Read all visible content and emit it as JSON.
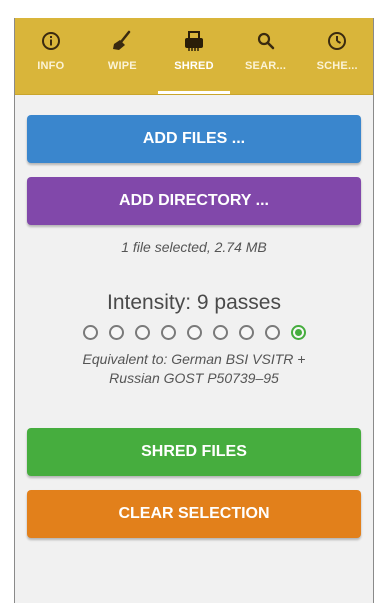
{
  "tabs": [
    {
      "label": "INFO",
      "icon": "info-icon"
    },
    {
      "label": "WIPE",
      "icon": "broom-icon"
    },
    {
      "label": "SHRED",
      "icon": "shredder-icon",
      "active": true
    },
    {
      "label": "SEAR...",
      "icon": "search-icon"
    },
    {
      "label": "SCHE...",
      "icon": "clock-icon"
    }
  ],
  "buttons": {
    "add_files": "ADD FILES ...",
    "add_directory": "ADD DIRECTORY ...",
    "shred_files": "SHRED FILES",
    "clear_selection": "CLEAR SELECTION"
  },
  "selection": {
    "info": "1 file selected, 2.74 MB"
  },
  "intensity": {
    "title": "Intensity: 9 passes",
    "selected_passes": 9,
    "max_passes": 9,
    "equivalent_line1": "Equivalent to: German BSI VSITR +",
    "equivalent_line2": "Russian GOST P50739–95"
  },
  "colors": {
    "tabbar": "#d9b53a",
    "add_files": "#3a86cd",
    "add_directory": "#8148aa",
    "shred": "#46ad3e",
    "clear": "#e2801b"
  }
}
